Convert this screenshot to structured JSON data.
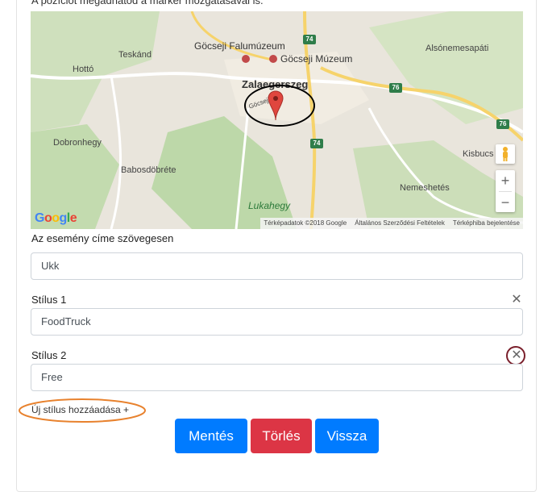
{
  "hint_text": "A pozíciót megadhatod a marker mozgatásával is.",
  "map": {
    "labels": {
      "falumuzeum": "Göcseji Falumúzeum",
      "muzeum": "Göcseji Múzeum",
      "city": "Zalaegerszeg",
      "teskand": "Teskánd",
      "hotto": "Hottó",
      "alsonemesapati": "Alsónemesapáti",
      "dobronhegy": "Dobronhegy",
      "babosdobrete": "Babosdöbréte",
      "lukahegy": "Lukahegy",
      "nemeshetes": "Nemeshetés",
      "kisbucs": "Kisbucs",
      "gocseji_ut": "Göcseji út"
    },
    "road_numbers": [
      "74",
      "76",
      "76",
      "74"
    ],
    "google_letters": [
      "G",
      "o",
      "o",
      "g",
      "l",
      "e"
    ],
    "attribution": {
      "data": "Térképadatok ©2018 Google",
      "terms": "Általános Szerződési Feltételek",
      "report": "Térképhiba bejelentése"
    },
    "zoom_in": "+",
    "zoom_out": "−"
  },
  "fields": {
    "title_label": "Az esemény címe szövegesen",
    "title_value": "Ukk",
    "style1_label": "Stílus 1",
    "style1_value": "FoodTruck",
    "style2_label": "Stílus 2",
    "style2_value": "Free",
    "remove_symbol": "✕"
  },
  "add_style_label": "Új stílus hozzáadása +",
  "buttons": {
    "save": "Mentés",
    "delete": "Törlés",
    "back": "Vissza"
  },
  "colors": {
    "primary": "#007bff",
    "danger": "#dc3545",
    "annotation_black": "#000000",
    "annotation_maroon": "#7a1f2b",
    "annotation_orange": "#e8822e"
  }
}
